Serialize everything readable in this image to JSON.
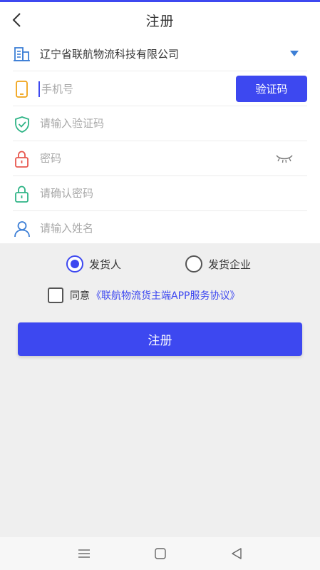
{
  "header": {
    "title": "注册"
  },
  "form": {
    "company": {
      "value": "辽宁省联航物流科技有限公司"
    },
    "phone": {
      "placeholder": "手机号"
    },
    "get_code_label": "验证码",
    "verify_code": {
      "placeholder": "请输入验证码"
    },
    "password": {
      "placeholder": "密码"
    },
    "confirm_password": {
      "placeholder": "请确认密码"
    },
    "name": {
      "placeholder": "请输入姓名"
    }
  },
  "role": {
    "options": [
      {
        "label": "发货人",
        "selected": true
      },
      {
        "label": "发货企业",
        "selected": false
      }
    ]
  },
  "agreement": {
    "checked": false,
    "prefix": "同意",
    "link": "《联航物流货主端APP服务协议》"
  },
  "submit_label": "注册",
  "colors": {
    "accent": "#3d48f0",
    "background": "#efefef"
  },
  "icons": {
    "back": "chevron-left-icon",
    "company": "building-icon",
    "phone": "phone-icon",
    "code": "shield-check-icon",
    "password": "lock-icon",
    "confirm": "lock-icon",
    "name": "person-icon",
    "dropdown": "caret-down-icon",
    "visibility": "eye-closed-icon"
  },
  "system_nav": [
    "menu-icon",
    "home-icon",
    "back-icon"
  ]
}
